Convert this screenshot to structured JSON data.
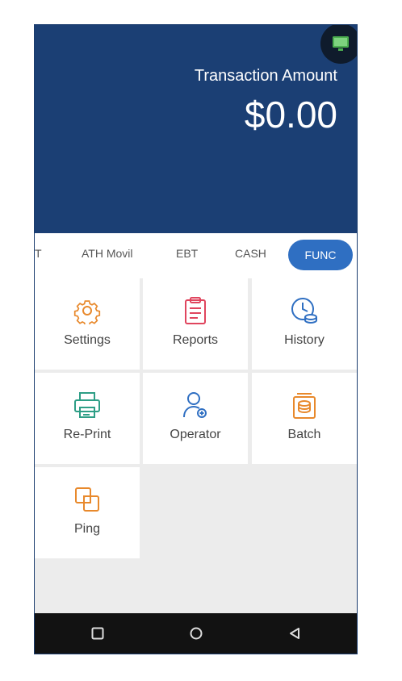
{
  "header": {
    "amount_label": "Transaction Amount",
    "amount_value": "$0.00",
    "status_icon": "terminal-status-icon"
  },
  "tabs": [
    {
      "label": "T"
    },
    {
      "label": "ATH Movil"
    },
    {
      "label": "EBT"
    },
    {
      "label": "CASH"
    },
    {
      "label": "FUNC",
      "selected": true
    }
  ],
  "functions": [
    {
      "label": "Settings",
      "icon": "gear-icon",
      "color": "#e8892c"
    },
    {
      "label": "Reports",
      "icon": "clipboard-icon",
      "color": "#e0455e"
    },
    {
      "label": "History",
      "icon": "clock-icon",
      "color": "#2f6fc2"
    },
    {
      "label": "Re-Print",
      "icon": "printer-icon",
      "color": "#2e9e86"
    },
    {
      "label": "Operator",
      "icon": "user-icon",
      "color": "#2f6fc2"
    },
    {
      "label": "Batch",
      "icon": "batch-icon",
      "color": "#e8892c"
    },
    {
      "label": "Ping",
      "icon": "ping-icon",
      "color": "#e8892c"
    }
  ],
  "colors": {
    "header_bg": "#1b3f74",
    "accent": "#2f6fc2",
    "nav_bg": "#121212"
  },
  "navbar": {
    "recent": "square-icon",
    "home": "circle-icon",
    "back": "triangle-back-icon"
  }
}
